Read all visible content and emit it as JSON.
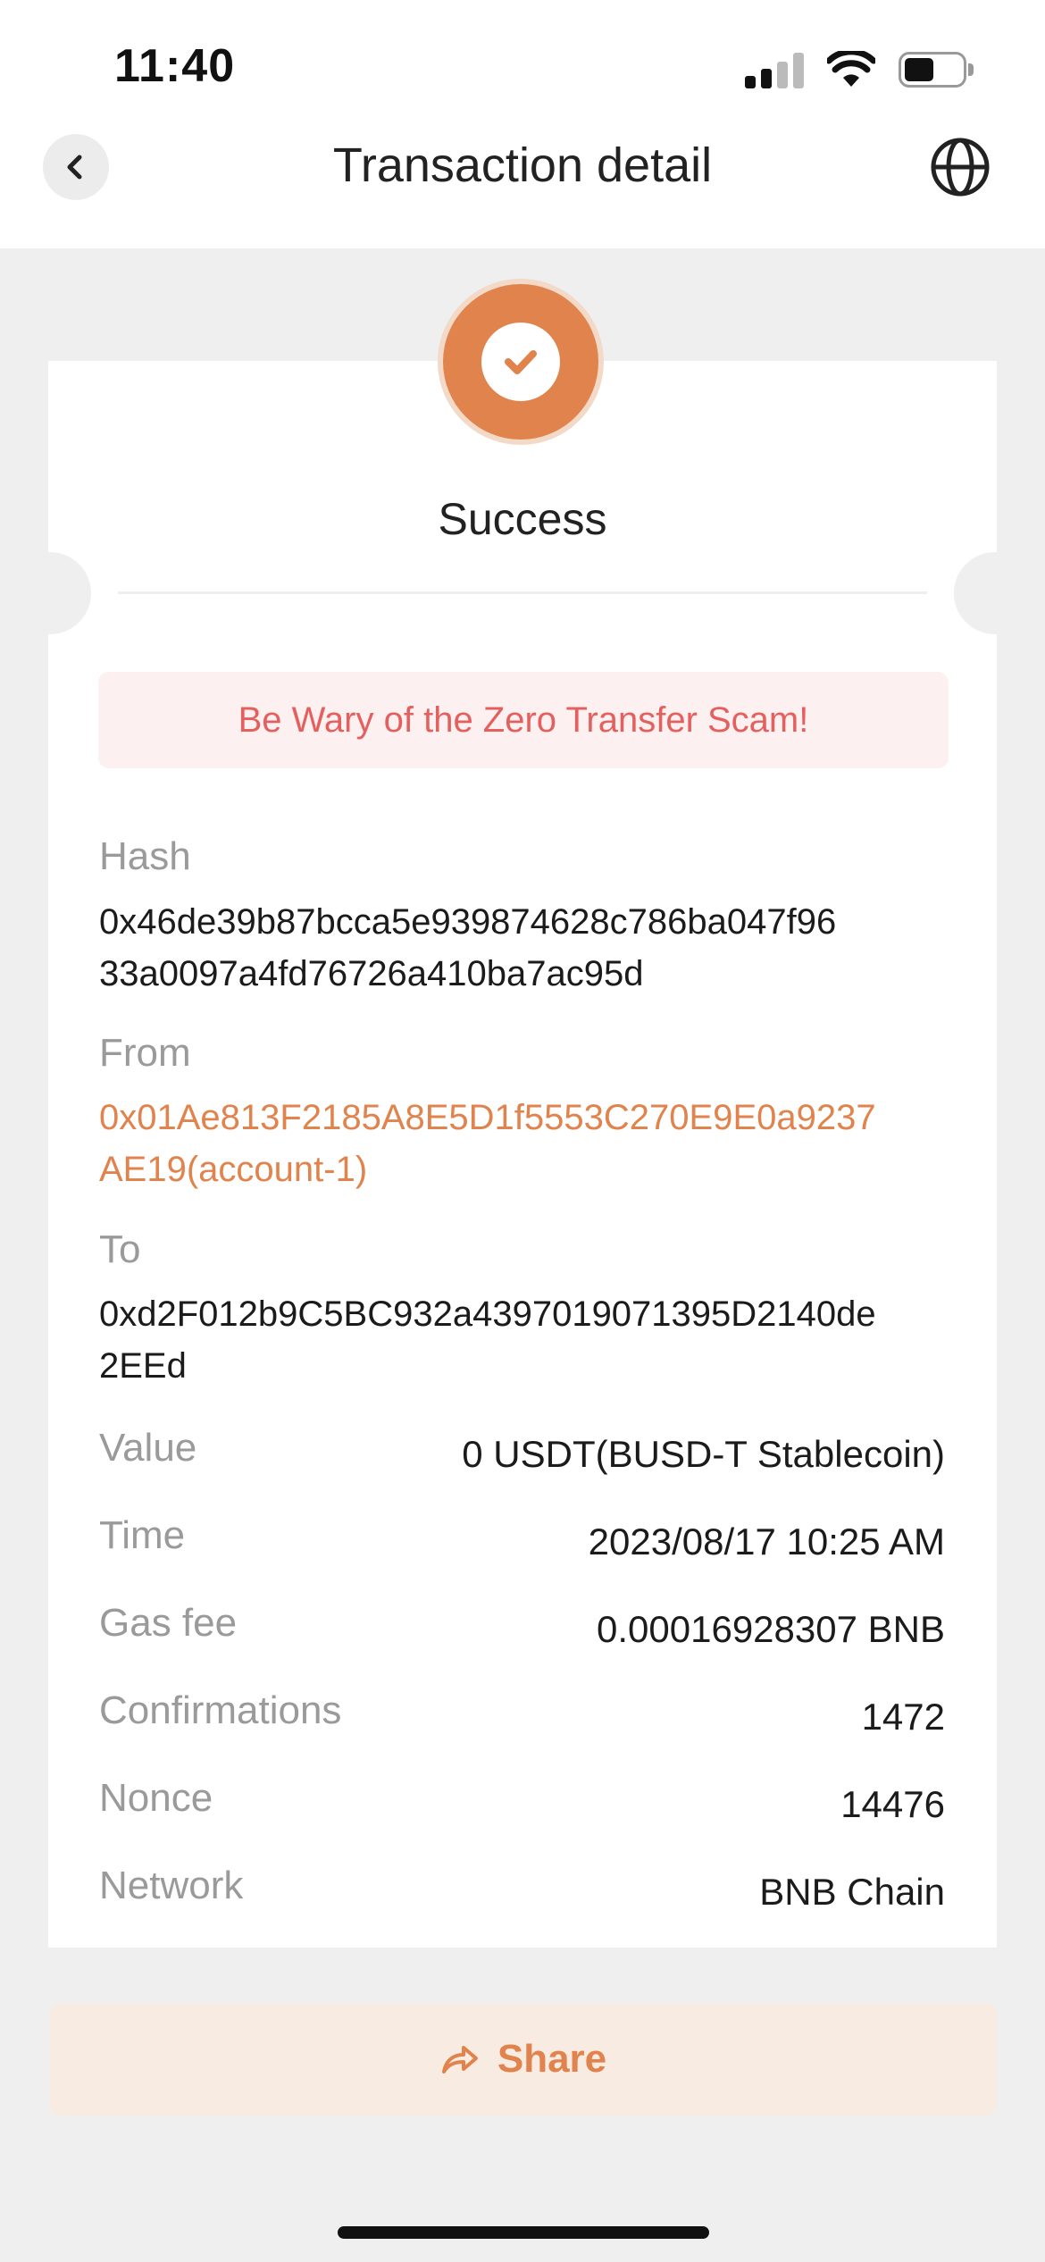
{
  "status_bar": {
    "time": "11:40"
  },
  "header": {
    "title": "Transaction detail"
  },
  "status": {
    "text": "Success",
    "color": "#e0834d"
  },
  "warning": {
    "text": "Be Wary of the Zero Transfer Scam!"
  },
  "fields": {
    "hash": {
      "label": "Hash",
      "line1": "0x46de39b87bcca5e939874628c786ba047f96",
      "line2": "33a0097a4fd76726a410ba7ac95d"
    },
    "from": {
      "label": "From",
      "line1": "0x01Ae813F2185A8E5D1f5553C270E9E0a9237",
      "line2": "AE19(account-1)"
    },
    "to": {
      "label": "To",
      "line1": "0xd2F012b9C5BC932a4397019071395D2140de",
      "line2": "2EEd"
    }
  },
  "details": [
    {
      "label": "Value",
      "value": "0 USDT(BUSD-T Stablecoin)"
    },
    {
      "label": "Time",
      "value": "2023/08/17 10:25 AM"
    },
    {
      "label": "Gas fee",
      "value": "0.00016928307 BNB"
    },
    {
      "label": "Confirmations",
      "value": "1472"
    },
    {
      "label": "Nonce",
      "value": "14476"
    },
    {
      "label": "Network",
      "value": "BNB Chain"
    }
  ],
  "share": {
    "label": "Share"
  },
  "colors": {
    "accent": "#e0834d",
    "warning_text": "#e4605e",
    "warning_bg": "#fdf0f0"
  }
}
